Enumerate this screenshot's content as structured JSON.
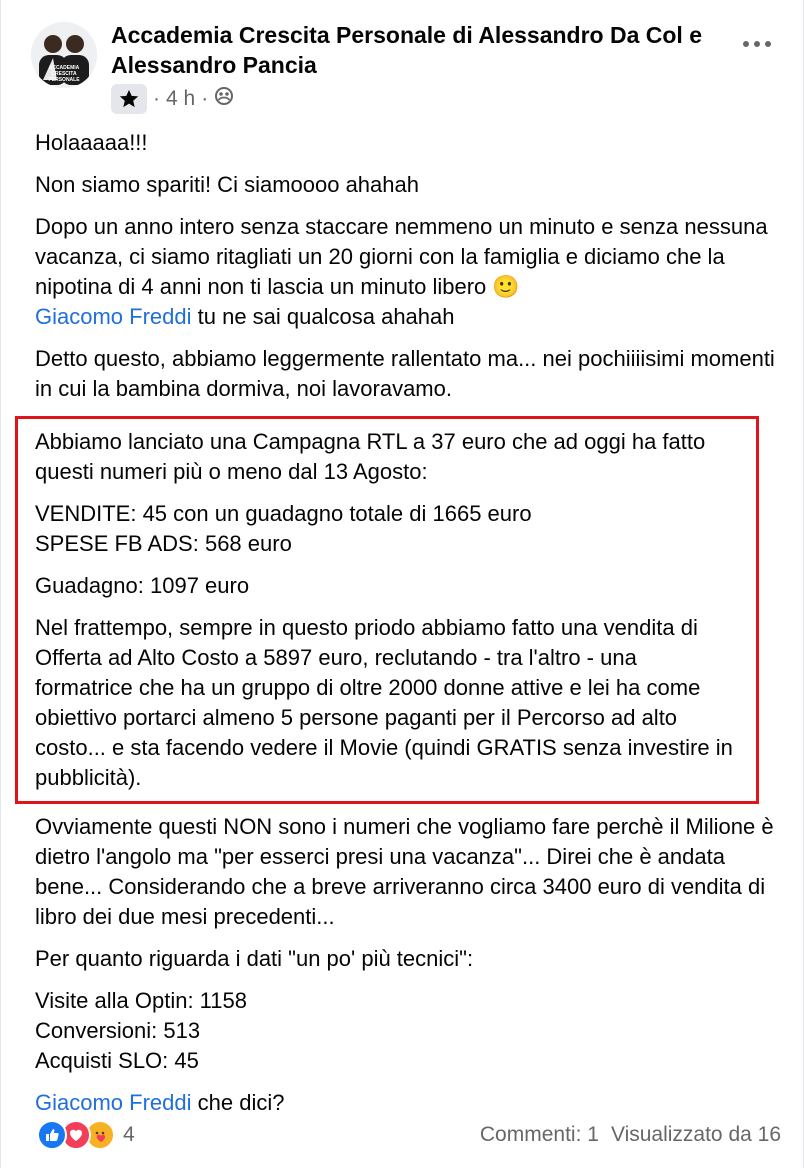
{
  "post": {
    "author": "Accademia Crescita Personale di Alessandro Da Col e Alessandro Pancia",
    "avatar_text": "ACCADEMIA CRESCITA PERSONALE",
    "time": "4 h",
    "separator": "·",
    "icons": {
      "badge": "star-icon",
      "audience": "group-icon",
      "menu": "more-options-icon"
    },
    "paragraphs": {
      "p1": "Holaaaaa!!!",
      "p2": "Non siamo spariti! Ci siamoooo ahahah",
      "p3": "Dopo un anno intero senza staccare nemmeno un minuto e senza nessuna vacanza, ci siamo ritagliati un 20 giorni con la famiglia e diciamo che la nipotina di 4 anni non ti lascia un minuto libero",
      "p3_emoji": "🙂",
      "p3_mention": "Giacomo Freddi",
      "p3_tail": " tu ne sai qualcosa ahahah",
      "p4": "Detto questo, abbiamo leggermente rallentato ma... nei pochiiiisimi momenti in cui la bambina dormiva, noi lavoravamo.",
      "h1": "Abbiamo lanciato una Campagna RTL a 37 euro che ad oggi ha fatto questi numeri più o meno dal 13 Agosto:",
      "h2a": "VENDITE: 45 con un guadagno totale di 1665 euro",
      "h2b": "SPESE FB ADS: 568 euro",
      "h3": "Guadagno: 1097 euro",
      "h4": "Nel frattempo, sempre in questo priodo abbiamo fatto una vendita di Offerta ad Alto Costo a 5897 euro, reclutando - tra l'altro - una formatrice che ha un gruppo di oltre 2000 donne attive e lei ha come obiettivo portarci almeno 5 persone paganti per il Percorso ad alto costo... e sta facendo vedere il Movie (quindi GRATIS senza investire in pubblicità).",
      "p5": "Ovviamente questi NON sono i numeri che vogliamo fare perchè il Milione è dietro l'angolo ma \"per esserci presi una vacanza\"... Direi che è andata bene... Considerando che a breve arriveranno circa 3400 euro di vendita di libro dei due mesi precedenti...",
      "p6": "Per quanto riguarda i dati \"un po' più tecnici\":",
      "p7a": "Visite alla Optin: 1158",
      "p7b": "Conversioni: 513",
      "p7c": "Acquisti SLO: 45",
      "p8_mention": "Giacomo Freddi",
      "p8_tail": " che dici?"
    },
    "footer": {
      "reaction_icons": [
        "like-icon",
        "love-icon",
        "care-icon"
      ],
      "reaction_count": "4",
      "comments": "Commenti: 1",
      "views": "Visualizzato da 16"
    },
    "colors": {
      "link": "#216fdb",
      "highlight_border": "#e0141b",
      "like": "#1877f2",
      "love": "#f33e58",
      "care": "#f7b125"
    }
  }
}
